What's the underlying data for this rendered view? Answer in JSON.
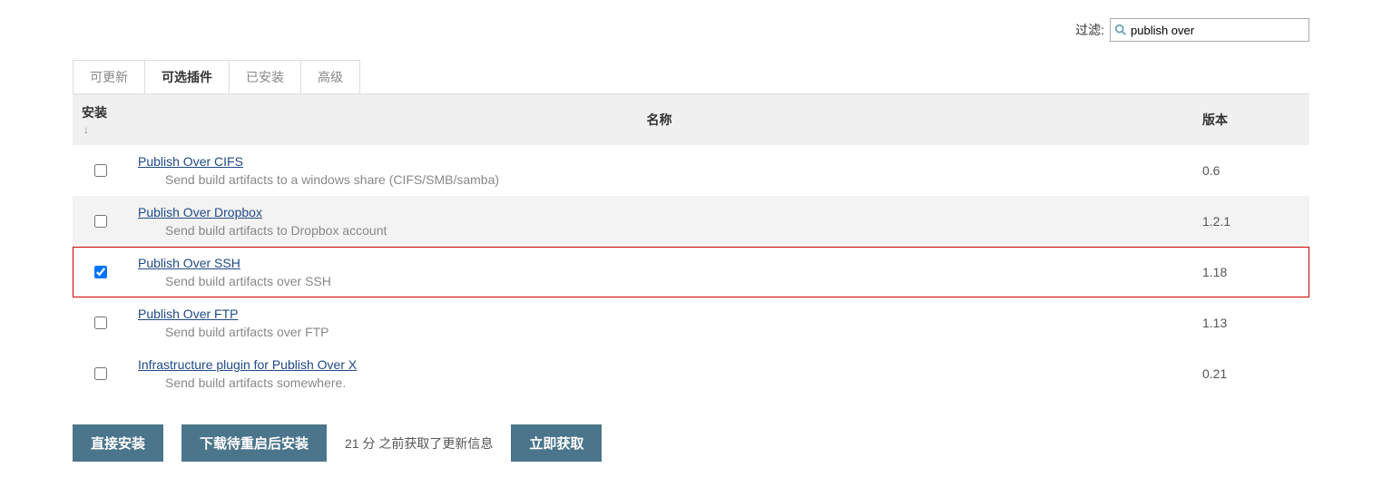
{
  "filter": {
    "label": "过滤:",
    "value": "publish over",
    "icon": "search-icon"
  },
  "tabs": [
    {
      "label": "可更新",
      "active": false
    },
    {
      "label": "可选插件",
      "active": true
    },
    {
      "label": "已安装",
      "active": false
    },
    {
      "label": "高级",
      "active": false
    }
  ],
  "table": {
    "headers": {
      "install": "安装",
      "sort_indicator": "↓",
      "name": "名称",
      "version": "版本"
    },
    "rows": [
      {
        "checked": false,
        "name": "Publish Over CIFS",
        "desc": "Send build artifacts to a windows share (CIFS/SMB/samba)",
        "version": "0.6",
        "alt": false,
        "highlight": false
      },
      {
        "checked": false,
        "name": "Publish Over Dropbox",
        "desc": "Send build artifacts to Dropbox account",
        "version": "1.2.1",
        "alt": true,
        "highlight": false
      },
      {
        "checked": true,
        "name": "Publish Over SSH",
        "desc": "Send build artifacts over SSH",
        "version": "1.18",
        "alt": false,
        "highlight": true
      },
      {
        "checked": false,
        "name": "Publish Over FTP",
        "desc": "Send build artifacts over FTP",
        "version": "1.13",
        "alt": false,
        "highlight": false
      },
      {
        "checked": false,
        "name": "Infrastructure plugin for Publish Over X",
        "desc": "Send build artifacts somewhere.",
        "version": "0.21",
        "alt": false,
        "highlight": false
      }
    ]
  },
  "buttons": {
    "install_now": "直接安装",
    "download_restart": "下载待重启后安装",
    "check_now": "立即获取"
  },
  "update_info": "21 分 之前获取了更新信息"
}
